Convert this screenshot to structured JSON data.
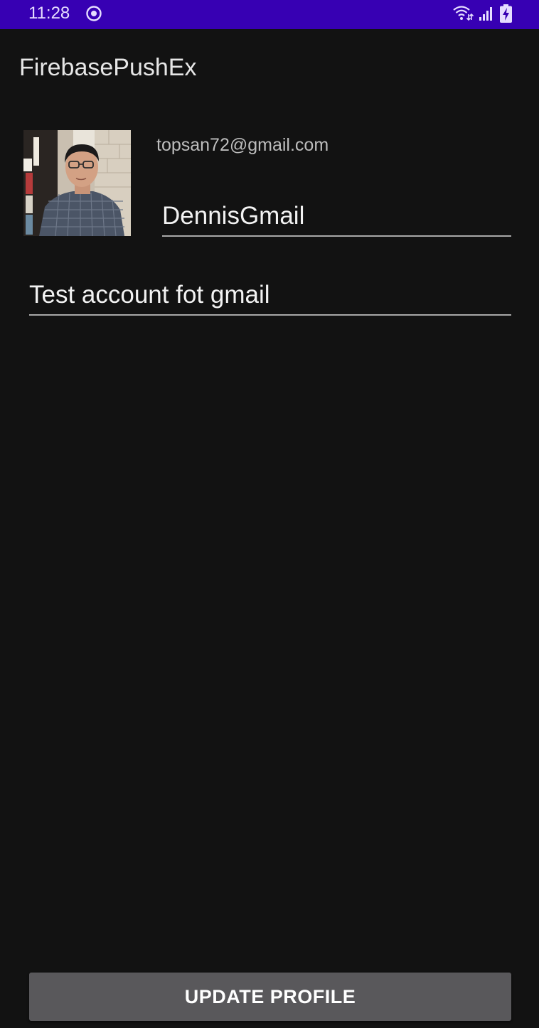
{
  "status_bar": {
    "time": "11:28",
    "background": "#3700b3"
  },
  "app_bar": {
    "title": "FirebasePushEx"
  },
  "profile": {
    "avatar_icon": "profile-photo",
    "email": "topsan72@gmail.com",
    "name_value": "DennisGmail",
    "description_value": "Test account fot gmail"
  },
  "actions": {
    "update_label": "UPDATE PROFILE",
    "button_color": "#59585b"
  },
  "theme": {
    "background": "#121212",
    "underline": "#a8a8a8"
  }
}
